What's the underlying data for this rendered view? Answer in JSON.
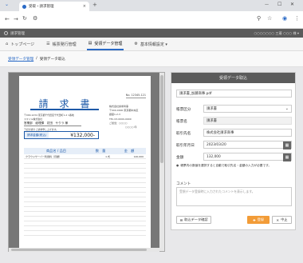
{
  "browser": {
    "tab_title": "受取・請求管理",
    "new_tab": "+",
    "close_tab": "×",
    "dropdown": "⌄",
    "minimize": "—",
    "maximize": "☐",
    "close": "✕"
  },
  "app": {
    "brand": "請求管理",
    "user_info": "○○○○○○○ 三菱  ○○○ 様 ▾"
  },
  "nav": {
    "items": [
      {
        "label": "トップページ"
      },
      {
        "label": "帳票発行管理"
      },
      {
        "label": "受領データ管理"
      },
      {
        "label": "基本情報設定 ▾"
      }
    ]
  },
  "breadcrumb": {
    "link": "受領データ管理",
    "sep": "/",
    "current": "受領データ取込"
  },
  "document": {
    "doc_no": "No. 12345-121",
    "title": "請　求　書",
    "customer_address": "〒000-1234 東京都千代田区千代田町1-2 1番地",
    "customer_name": "スマイル株式会社",
    "customer_dept": "営業部　経理課　花田　サクラ 様",
    "intro": "下記の通りご請求申し上げます。",
    "amount_label": "請求金額(税込)",
    "amount": "¥132,000-",
    "company_name": "株式会社請求商事",
    "company_addr1": "〒000-0000 東京都中央区",
    "company_addr2": "銀座1-2-3",
    "company_tel": "TEL 03-0000-0000",
    "company_dept": "ご担当：○○○○",
    "stamp": "○○○○ 印",
    "col_item": "商品名 / 品目",
    "col_qty": "数　量",
    "col_price": "金　額",
    "item_name": "クラウドサーバー利用料（月額）",
    "item_qty": "1 式",
    "item_price": "120,000"
  },
  "panel": {
    "header": "受領データ取込",
    "file_name": "請求書_加藤商事.pdf",
    "type_label": "帳票区分",
    "type_value": "請求書",
    "type_icon": "chevron-down-icon",
    "name_label": "帳票名",
    "name_value": "請求書",
    "issuer_label": "取引先名",
    "issuer_value": "株式会社請求商事",
    "date_label": "取引年月日",
    "date_value": "2023/03/20",
    "amount_label": "金額",
    "amount_value": "132,000",
    "warning": "帳票内の数値を選択すると自動で取引先名・金額の入力が必要です。",
    "comment_label": "コメント",
    "comment_placeholder": "受領データ登録時に入力されたコメントを表示します。",
    "edit_button": "取込データ確認",
    "register_button": "登録",
    "cancel_button": "中止"
  },
  "icons": {
    "back": "←",
    "forward": "→",
    "reload": "↻",
    "settings": "⚙",
    "pin": "⚲",
    "star": "☆",
    "profile": "◉",
    "menu": "⋮",
    "nav_home": "⌂",
    "nav_doc": "☰",
    "nav_recv": "▤",
    "nav_gear": "⚙",
    "calendar": "▦",
    "warning": "●",
    "edit": "☰",
    "save": "✚",
    "cancel": "✕"
  },
  "colors": {
    "accent": "#2a6ac6",
    "header_bg": "#5b5b5b",
    "invoice_blue": "#1e5aa8",
    "register_orange": "#f29c38"
  }
}
